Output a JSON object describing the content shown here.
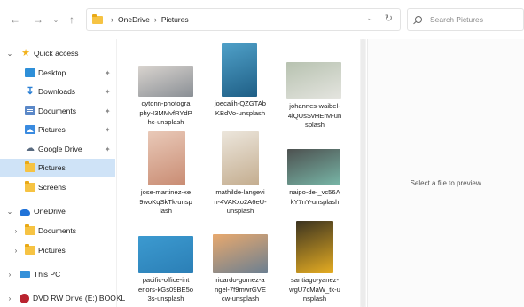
{
  "address": {
    "crumbs": [
      "OneDrive",
      "Pictures"
    ]
  },
  "search": {
    "placeholder": "Search Pictures"
  },
  "sidebar": {
    "items": [
      {
        "label": "Quick access",
        "icon": "star-icon"
      },
      {
        "label": "Desktop",
        "icon": "desktop-icon",
        "pinned": true
      },
      {
        "label": "Downloads",
        "icon": "download-icon",
        "pinned": true
      },
      {
        "label": "Documents",
        "icon": "documents-icon",
        "pinned": true
      },
      {
        "label": "Pictures",
        "icon": "pictures-icon",
        "pinned": true
      },
      {
        "label": "Google Drive",
        "icon": "google-drive-icon",
        "pinned": true
      },
      {
        "label": "Pictures",
        "icon": "folder-icon",
        "selected": true
      },
      {
        "label": "Screens",
        "icon": "folder-icon"
      },
      {
        "label": "OneDrive",
        "icon": "onedrive-cloud-icon"
      },
      {
        "label": "Documents",
        "icon": "folder-icon"
      },
      {
        "label": "Pictures",
        "icon": "folder-icon"
      },
      {
        "label": "This PC",
        "icon": "pc-icon"
      },
      {
        "label": "DVD RW Drive (E:) BOOKL",
        "icon": "dvd-drive-icon"
      }
    ]
  },
  "files": [
    {
      "name": "cytonn-photography-I3MMvfRYdPhc-unsplash",
      "lines": [
        "cytonn-photogra",
        "phy-I3MMvfRYdP",
        "hc-unsplash"
      ],
      "colors": [
        "#d9d4cf",
        "#8a8f95"
      ]
    },
    {
      "name": "joecalih-QZGTAbKBdVo-unsplash",
      "lines": [
        "joecalih-QZGTAb",
        "KBdVo-unsplash"
      ],
      "colors": [
        "#4fa0c8",
        "#1f5f86"
      ]
    },
    {
      "name": "johannes-waibel-4iQUsSvHErM-unsplash",
      "lines": [
        "johannes-waibel-",
        "4iQUsSvHErM-un",
        "splash"
      ],
      "colors": [
        "#b7c2b0",
        "#e5e5e0"
      ]
    },
    {
      "name": "jose-martinez-xe9woKqSkTk-unsplash",
      "lines": [
        "jose-martinez-xe",
        "9woKqSkTk-unsp",
        "lash"
      ],
      "colors": [
        "#e9c9b8",
        "#c98c73"
      ]
    },
    {
      "name": "mathilde-langevin-4VAKxo2A6eU-unsplash",
      "lines": [
        "mathilde-langevi",
        "n-4VAKxo2A6eU-",
        "unsplash"
      ],
      "colors": [
        "#ece6dc",
        "#c4ad8f"
      ]
    },
    {
      "name": "naipo-de-_vc56AkY7nY-unsplash",
      "lines": [
        "naipo-de-_vc56A",
        "kY7nY-unsplash"
      ],
      "colors": [
        "#4d5150",
        "#77b5a6"
      ]
    },
    {
      "name": "pacific-office-interiors-kGs09BE5o3s-unsplash",
      "lines": [
        "pacific-office-int",
        "eriors-kGs09BE5o",
        "3s-unsplash"
      ],
      "colors": [
        "#3c9ad0",
        "#2b7fb6"
      ]
    },
    {
      "name": "ricardo-gomez-angel-7f9mwrGVEcw-unsplash",
      "lines": [
        "ricardo-gomez-a",
        "ngel-7f9mwrGVE",
        "cw-unsplash"
      ],
      "colors": [
        "#e8a96e",
        "#6b7f91"
      ]
    },
    {
      "name": "santiago-yanez-wgU7cMaW_tk-unsplash",
      "lines": [
        "santiago-yanez-",
        "wgU7cMaW_tk-u",
        "nsplash"
      ],
      "colors": [
        "#3b3320",
        "#e6ad22"
      ]
    }
  ],
  "preview": {
    "message": "Select a file to preview."
  }
}
